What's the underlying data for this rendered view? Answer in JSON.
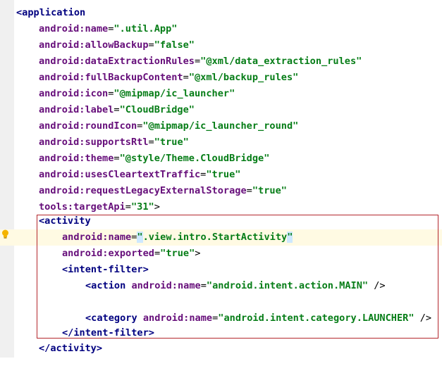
{
  "lines": [
    {
      "tag": "<application"
    },
    {
      "ns": "android",
      "attr": "name",
      "val": "\".util.App\""
    },
    {
      "ns": "android",
      "attr": "allowBackup",
      "val": "\"false\""
    },
    {
      "ns": "android",
      "attr": "dataExtractionRules",
      "val": "\"@xml/data_extraction_rules\""
    },
    {
      "ns": "android",
      "attr": "fullBackupContent",
      "val": "\"@xml/backup_rules\""
    },
    {
      "ns": "android",
      "attr": "icon",
      "val": "\"@mipmap/ic_launcher\""
    },
    {
      "ns": "android",
      "attr": "label",
      "val": "\"CloudBridge\""
    },
    {
      "ns": "android",
      "attr": "roundIcon",
      "val": "\"@mipmap/ic_launcher_round\""
    },
    {
      "ns": "android",
      "attr": "supportsRtl",
      "val": "\"true\""
    },
    {
      "ns": "android",
      "attr": "theme",
      "val": "\"@style/Theme.CloudBridge\""
    },
    {
      "ns": "android",
      "attr": "usesCleartextTraffic",
      "val": "\"true\""
    },
    {
      "ns": "android",
      "attr": "requestLegacyExternalStorage",
      "val": "\"true\""
    },
    {
      "ns": "tools",
      "attr": "targetApi",
      "val": "\"31\"",
      "end": ">"
    },
    {
      "tag": "<activity"
    },
    {
      "ns": "android",
      "attr": "name",
      "val_open": "\"",
      "val_body": ".view.intro.StartActivity",
      "val_close": "\""
    },
    {
      "ns": "android",
      "attr": "exported",
      "val": "\"true\"",
      "end": ">"
    },
    {
      "tag": "<intent-filter>"
    },
    {
      "tag": "<action",
      "ns": "android",
      "attr": "name",
      "val": "\"android.intent.action.MAIN\"",
      "end": " />"
    },
    {
      "tag": "<category",
      "ns": "android",
      "attr": "name",
      "val": "\"android.intent.category.LAUNCHER\"",
      "end": " />"
    },
    {
      "tag": "</intent-filter>"
    },
    {
      "tag": "</activity>"
    }
  ],
  "icons": {
    "gutter_marker": "lightbulb-icon"
  }
}
